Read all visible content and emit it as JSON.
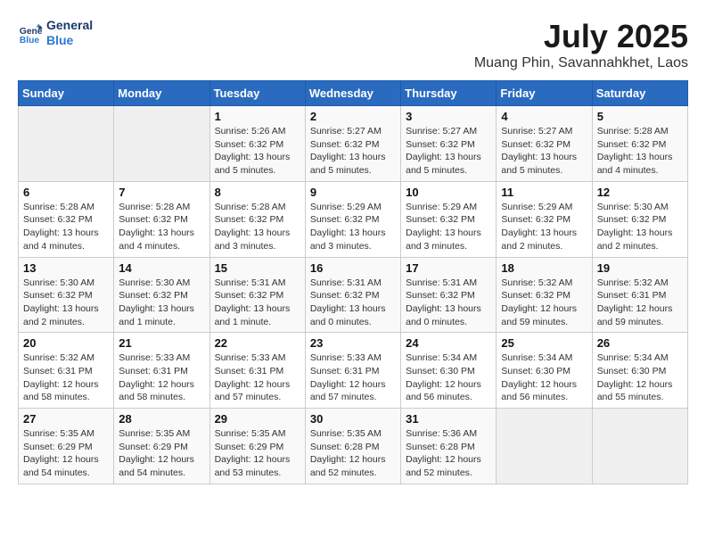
{
  "header": {
    "logo_line1": "General",
    "logo_line2": "Blue",
    "month": "July 2025",
    "location": "Muang Phin, Savannahkhet, Laos"
  },
  "weekdays": [
    "Sunday",
    "Monday",
    "Tuesday",
    "Wednesday",
    "Thursday",
    "Friday",
    "Saturday"
  ],
  "weeks": [
    [
      {
        "day": "",
        "info": ""
      },
      {
        "day": "",
        "info": ""
      },
      {
        "day": "1",
        "info": "Sunrise: 5:26 AM\nSunset: 6:32 PM\nDaylight: 13 hours\nand 5 minutes."
      },
      {
        "day": "2",
        "info": "Sunrise: 5:27 AM\nSunset: 6:32 PM\nDaylight: 13 hours\nand 5 minutes."
      },
      {
        "day": "3",
        "info": "Sunrise: 5:27 AM\nSunset: 6:32 PM\nDaylight: 13 hours\nand 5 minutes."
      },
      {
        "day": "4",
        "info": "Sunrise: 5:27 AM\nSunset: 6:32 PM\nDaylight: 13 hours\nand 5 minutes."
      },
      {
        "day": "5",
        "info": "Sunrise: 5:28 AM\nSunset: 6:32 PM\nDaylight: 13 hours\nand 4 minutes."
      }
    ],
    [
      {
        "day": "6",
        "info": "Sunrise: 5:28 AM\nSunset: 6:32 PM\nDaylight: 13 hours\nand 4 minutes."
      },
      {
        "day": "7",
        "info": "Sunrise: 5:28 AM\nSunset: 6:32 PM\nDaylight: 13 hours\nand 4 minutes."
      },
      {
        "day": "8",
        "info": "Sunrise: 5:28 AM\nSunset: 6:32 PM\nDaylight: 13 hours\nand 3 minutes."
      },
      {
        "day": "9",
        "info": "Sunrise: 5:29 AM\nSunset: 6:32 PM\nDaylight: 13 hours\nand 3 minutes."
      },
      {
        "day": "10",
        "info": "Sunrise: 5:29 AM\nSunset: 6:32 PM\nDaylight: 13 hours\nand 3 minutes."
      },
      {
        "day": "11",
        "info": "Sunrise: 5:29 AM\nSunset: 6:32 PM\nDaylight: 13 hours\nand 2 minutes."
      },
      {
        "day": "12",
        "info": "Sunrise: 5:30 AM\nSunset: 6:32 PM\nDaylight: 13 hours\nand 2 minutes."
      }
    ],
    [
      {
        "day": "13",
        "info": "Sunrise: 5:30 AM\nSunset: 6:32 PM\nDaylight: 13 hours\nand 2 minutes."
      },
      {
        "day": "14",
        "info": "Sunrise: 5:30 AM\nSunset: 6:32 PM\nDaylight: 13 hours\nand 1 minute."
      },
      {
        "day": "15",
        "info": "Sunrise: 5:31 AM\nSunset: 6:32 PM\nDaylight: 13 hours\nand 1 minute."
      },
      {
        "day": "16",
        "info": "Sunrise: 5:31 AM\nSunset: 6:32 PM\nDaylight: 13 hours\nand 0 minutes."
      },
      {
        "day": "17",
        "info": "Sunrise: 5:31 AM\nSunset: 6:32 PM\nDaylight: 13 hours\nand 0 minutes."
      },
      {
        "day": "18",
        "info": "Sunrise: 5:32 AM\nSunset: 6:32 PM\nDaylight: 12 hours\nand 59 minutes."
      },
      {
        "day": "19",
        "info": "Sunrise: 5:32 AM\nSunset: 6:31 PM\nDaylight: 12 hours\nand 59 minutes."
      }
    ],
    [
      {
        "day": "20",
        "info": "Sunrise: 5:32 AM\nSunset: 6:31 PM\nDaylight: 12 hours\nand 58 minutes."
      },
      {
        "day": "21",
        "info": "Sunrise: 5:33 AM\nSunset: 6:31 PM\nDaylight: 12 hours\nand 58 minutes."
      },
      {
        "day": "22",
        "info": "Sunrise: 5:33 AM\nSunset: 6:31 PM\nDaylight: 12 hours\nand 57 minutes."
      },
      {
        "day": "23",
        "info": "Sunrise: 5:33 AM\nSunset: 6:31 PM\nDaylight: 12 hours\nand 57 minutes."
      },
      {
        "day": "24",
        "info": "Sunrise: 5:34 AM\nSunset: 6:30 PM\nDaylight: 12 hours\nand 56 minutes."
      },
      {
        "day": "25",
        "info": "Sunrise: 5:34 AM\nSunset: 6:30 PM\nDaylight: 12 hours\nand 56 minutes."
      },
      {
        "day": "26",
        "info": "Sunrise: 5:34 AM\nSunset: 6:30 PM\nDaylight: 12 hours\nand 55 minutes."
      }
    ],
    [
      {
        "day": "27",
        "info": "Sunrise: 5:35 AM\nSunset: 6:29 PM\nDaylight: 12 hours\nand 54 minutes."
      },
      {
        "day": "28",
        "info": "Sunrise: 5:35 AM\nSunset: 6:29 PM\nDaylight: 12 hours\nand 54 minutes."
      },
      {
        "day": "29",
        "info": "Sunrise: 5:35 AM\nSunset: 6:29 PM\nDaylight: 12 hours\nand 53 minutes."
      },
      {
        "day": "30",
        "info": "Sunrise: 5:35 AM\nSunset: 6:28 PM\nDaylight: 12 hours\nand 52 minutes."
      },
      {
        "day": "31",
        "info": "Sunrise: 5:36 AM\nSunset: 6:28 PM\nDaylight: 12 hours\nand 52 minutes."
      },
      {
        "day": "",
        "info": ""
      },
      {
        "day": "",
        "info": ""
      }
    ]
  ]
}
